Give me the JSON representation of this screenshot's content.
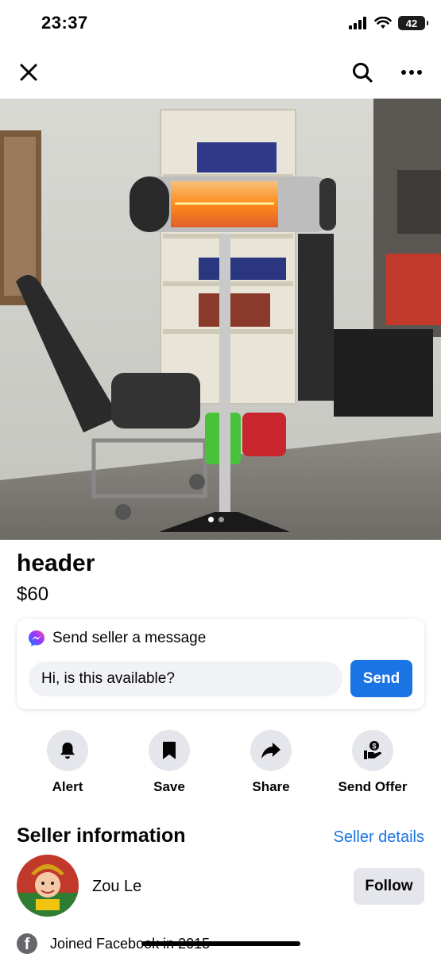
{
  "status_bar": {
    "time": "23:37",
    "battery": "42"
  },
  "nav": {
    "close_icon": "close-icon",
    "search_icon": "search-icon",
    "more_icon": "more-icon"
  },
  "listing": {
    "title": "header",
    "price": "$60",
    "image_dots": 2,
    "active_dot": 1
  },
  "message": {
    "heading": "Send seller a message",
    "input_value": "Hi, is this available?",
    "send_label": "Send"
  },
  "actions": [
    {
      "label": "Alert",
      "icon": "bell-icon"
    },
    {
      "label": "Save",
      "icon": "bookmark-icon"
    },
    {
      "label": "Share",
      "icon": "share-icon"
    },
    {
      "label": "Send Offer",
      "icon": "offer-icon"
    }
  ],
  "seller": {
    "section_title": "Seller information",
    "details_link": "Seller details",
    "name": "Zou Le",
    "follow_label": "Follow",
    "joined": "Joined Facebook in 2015"
  },
  "colors": {
    "accent": "#1b74e4",
    "button_bg": "#e4e6eb",
    "input_bg": "#f0f2f5"
  }
}
